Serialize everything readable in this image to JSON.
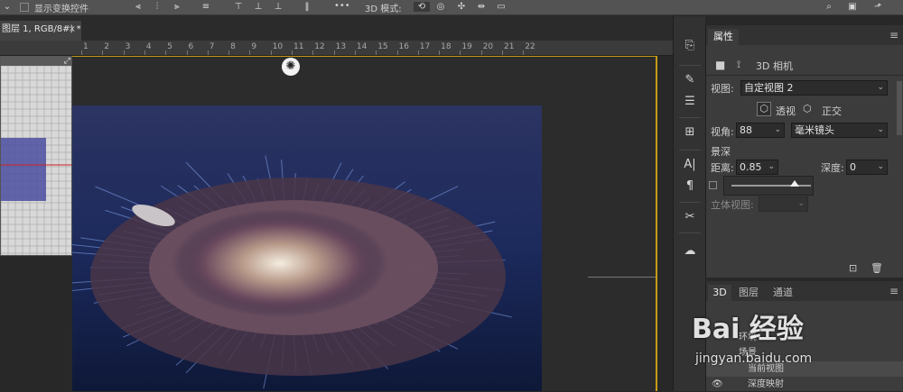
{
  "options_bar": {
    "show_transform_controls": "显示变换控件",
    "mode_3d_label": "3D 模式:",
    "more_label": "•••"
  },
  "document": {
    "tab_title": "图层 1, RGB/8#) *",
    "tab_close": "×",
    "ruler_ticks": [
      "1",
      "2",
      "3",
      "4",
      "5",
      "6",
      "7",
      "8",
      "9",
      "10",
      "11",
      "12",
      "13",
      "14",
      "15",
      "16",
      "17",
      "18",
      "19",
      "20",
      "21",
      "22"
    ]
  },
  "properties": {
    "tab_label": "属性",
    "header_title": "3D 相机",
    "view_label": "视图:",
    "view_value": "自定视图 2",
    "perspective_label": "透视",
    "ortho_label": "正交",
    "fov_label": "视角:",
    "fov_value": "88",
    "lens_value": "毫米镜头",
    "dof_label": "景深",
    "distance_label": "距离:",
    "distance_value": "0.85",
    "depth_label": "深度:",
    "depth_value": "0",
    "stereo_label": "立体视图:"
  },
  "panel3d": {
    "tabs": [
      "3D",
      "图层",
      "通道"
    ],
    "rows": [
      "环境",
      "场景",
      "当前视图",
      "深度映射"
    ]
  },
  "watermark": {
    "brand": "Bai 经验",
    "url": "jingyan.baidu.com"
  },
  "colors": {
    "accent_border": "#c79a17",
    "panel_bg": "#3c3c3c",
    "canvas_bg": "#282828"
  }
}
